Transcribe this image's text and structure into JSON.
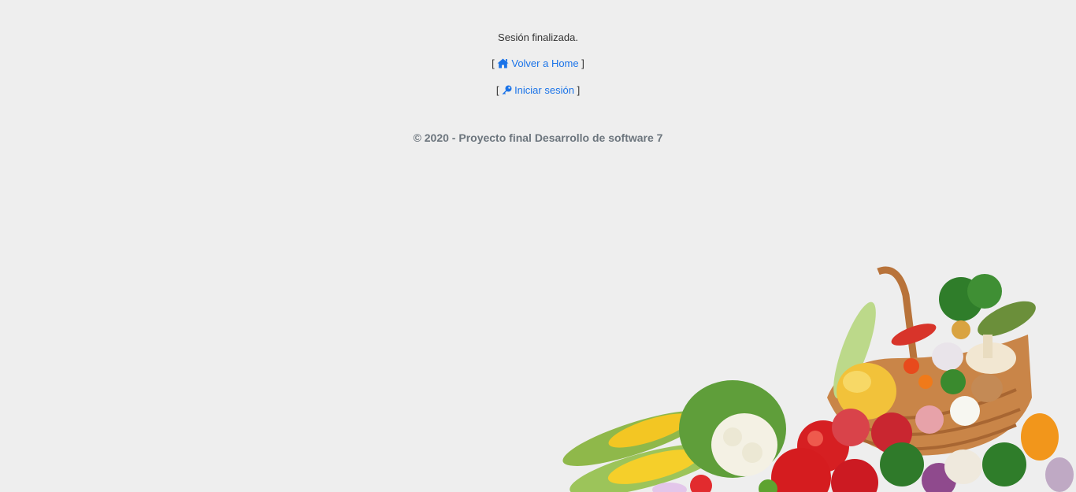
{
  "message": {
    "session_ended": "Sesión finalizada."
  },
  "links": {
    "home": {
      "label": "Volver a Home",
      "icon": "home-icon"
    },
    "login": {
      "label": "Iniciar sesión",
      "icon": "key-icon"
    }
  },
  "brackets": {
    "open": "[",
    "close": "]"
  },
  "footer": {
    "copyright": "© 2020 - Proyecto final Desarrollo de software 7"
  },
  "colors": {
    "background": "#eeeeee",
    "link": "#1a73e8",
    "footer_text": "#6c757d"
  }
}
